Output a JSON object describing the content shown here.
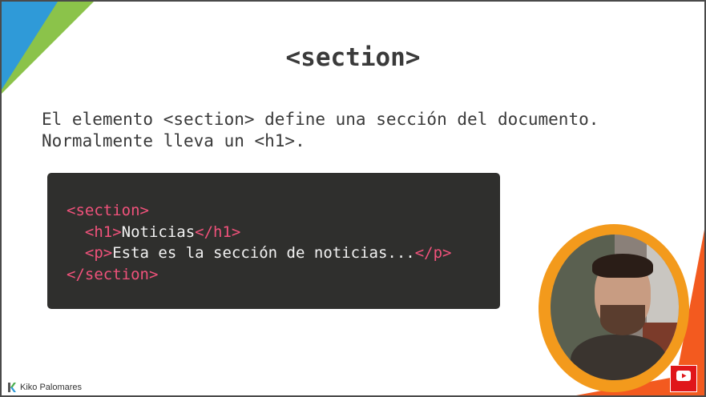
{
  "slide": {
    "title": "<section>",
    "description_line1": "El elemento <section> define una sección del documento.",
    "description_line2": "Normalmente lleva un <h1>."
  },
  "code": {
    "line1_open": "<section>",
    "line2_open": "<h1>",
    "line2_text": "Noticias",
    "line2_close": "</h1>",
    "line3_open": "<p>",
    "line3_text": "Esta es la sección de noticias...",
    "line3_close": "</p>",
    "line4_close": "</section>"
  },
  "colors": {
    "code_background": "#2f2f2d",
    "tag_color": "#f0527b",
    "accent_blue": "#2f9ad8",
    "accent_green": "#8bc34a",
    "accent_orange": "#f35a1f"
  },
  "branding": {
    "author": "Kiko Palomares",
    "subscribe_icon": "youtube-subscribe-icon"
  }
}
